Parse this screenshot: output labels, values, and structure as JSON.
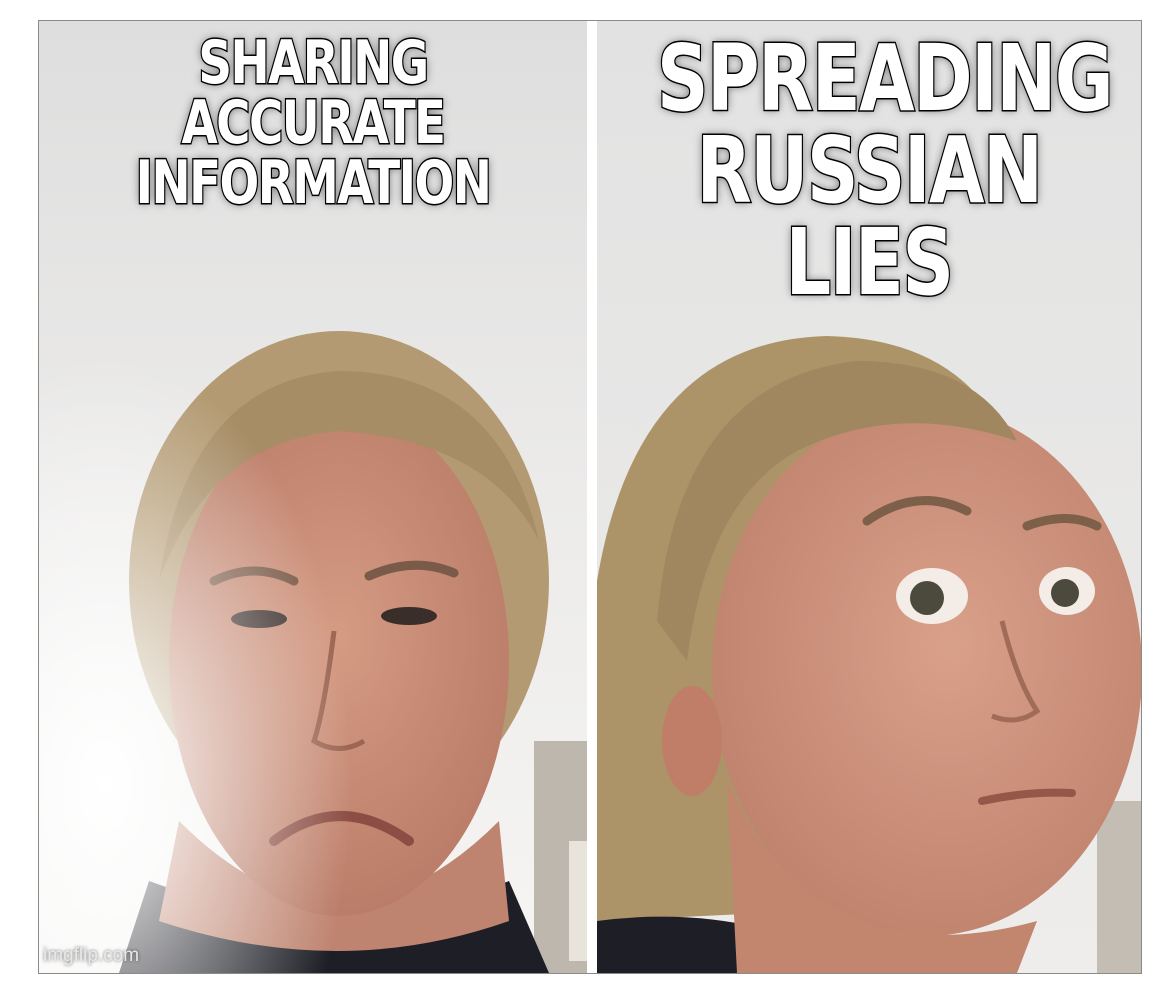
{
  "meme": {
    "left_caption": [
      "SHARING ACCURATE",
      "INFORMATION"
    ],
    "right_caption": [
      "SPREADING",
      "RUSSIAN LIES"
    ],
    "watermark": "imgflip.com"
  },
  "colors": {
    "caption_fill": "#ffffff",
    "caption_stroke": "#000000",
    "wall": "#ecebea",
    "skin": "#c98f79",
    "hair": "#b39a72",
    "shirt": "#1e1f26"
  }
}
